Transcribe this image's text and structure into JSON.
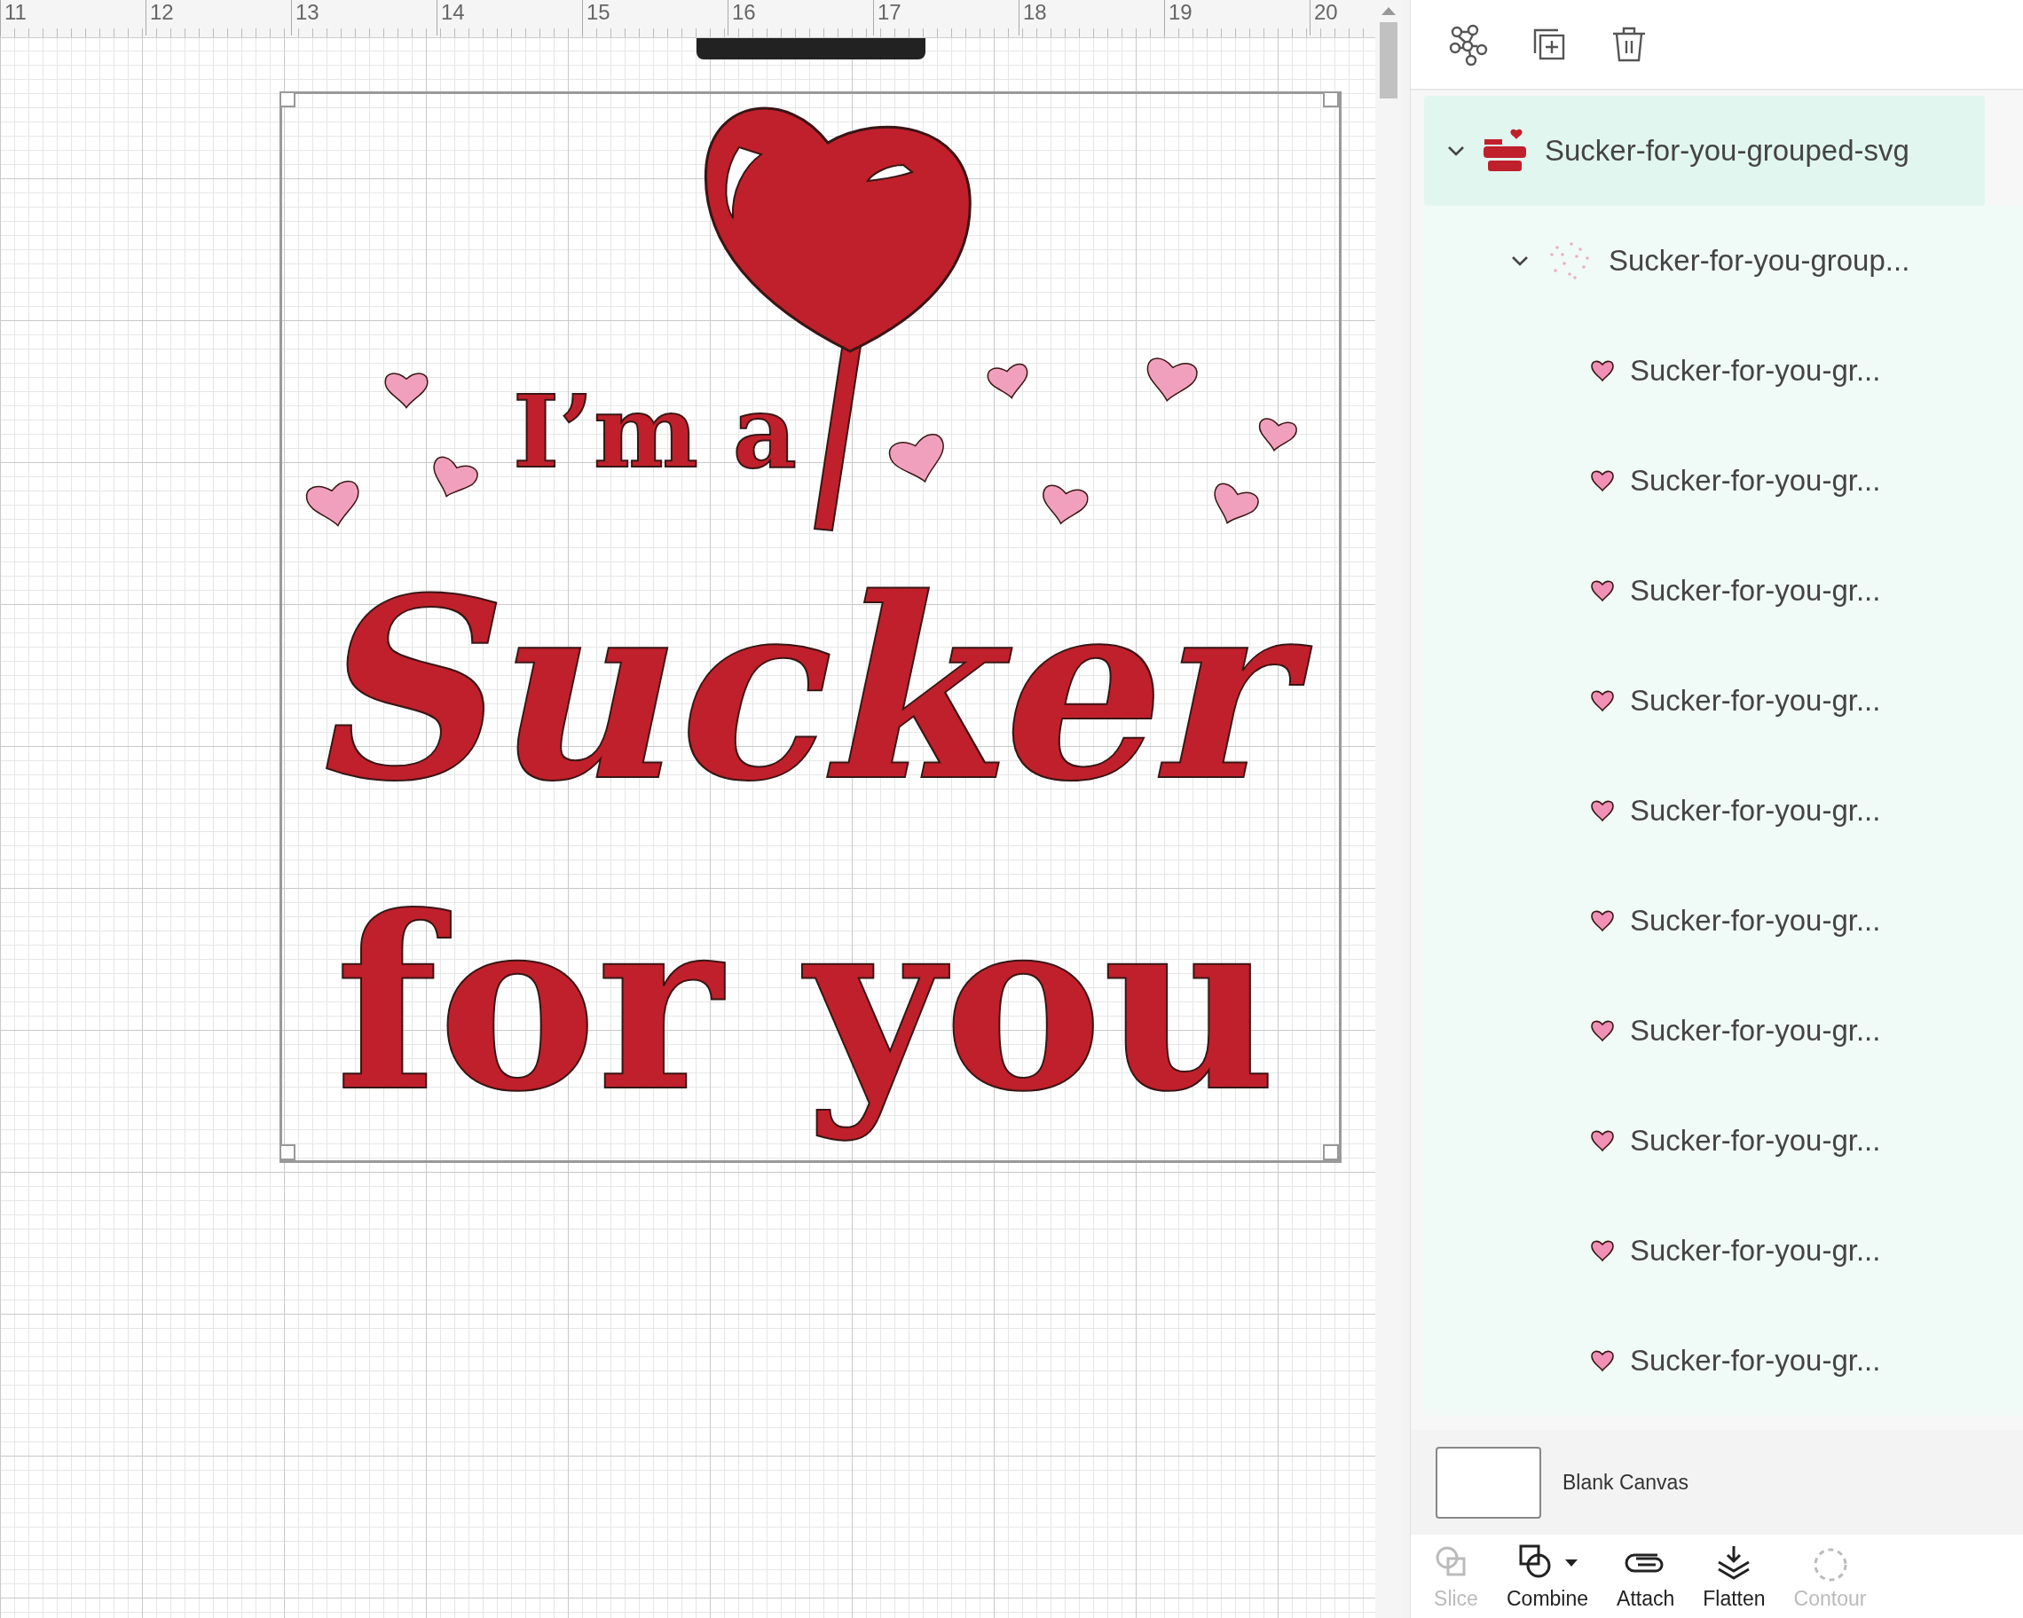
{
  "ruler": {
    "labels": [
      "11",
      "12",
      "13",
      "14",
      "15",
      "16",
      "17",
      "18",
      "19",
      "20"
    ]
  },
  "artwork": {
    "lines": [
      {
        "kind": "small",
        "text": "I’m a"
      },
      {
        "kind": "script",
        "text": "Sucker"
      },
      {
        "kind": "block",
        "text": "for you"
      }
    ]
  },
  "layers": [
    {
      "label": "Sucker-for-you-grouped-svg",
      "kind": "design",
      "selected": true,
      "expanded": true,
      "children": [
        {
          "label": "Sucker-for-you-group...",
          "kind": "dots",
          "selected": false,
          "expanded": true,
          "children": [
            {
              "label": "Sucker-for-you-gr...",
              "kind": "heart",
              "selected": false
            },
            {
              "label": "Sucker-for-you-gr...",
              "kind": "heart",
              "selected": false
            },
            {
              "label": "Sucker-for-you-gr...",
              "kind": "heart",
              "selected": false
            },
            {
              "label": "Sucker-for-you-gr...",
              "kind": "heart",
              "selected": false
            },
            {
              "label": "Sucker-for-you-gr...",
              "kind": "heart",
              "selected": false
            },
            {
              "label": "Sucker-for-you-gr...",
              "kind": "heart",
              "selected": false
            },
            {
              "label": "Sucker-for-you-gr...",
              "kind": "heart",
              "selected": false
            },
            {
              "label": "Sucker-for-you-gr...",
              "kind": "heart",
              "selected": false
            },
            {
              "label": "Sucker-for-you-gr...",
              "kind": "heart",
              "selected": false
            },
            {
              "label": "Sucker-for-you-gr...",
              "kind": "heart",
              "selected": false
            }
          ]
        }
      ]
    }
  ],
  "canvas_layer": {
    "label": "Blank Canvas"
  },
  "tools": [
    {
      "kind": "slice",
      "label": "Slice",
      "disabled": true,
      "dropdown": false
    },
    {
      "kind": "combine",
      "label": "Combine",
      "disabled": false,
      "dropdown": true
    },
    {
      "kind": "attach",
      "label": "Attach",
      "disabled": false,
      "dropdown": false
    },
    {
      "kind": "flatten",
      "label": "Flatten",
      "disabled": false,
      "dropdown": false
    },
    {
      "kind": "contour",
      "label": "Contour",
      "disabled": true,
      "dropdown": false
    }
  ]
}
